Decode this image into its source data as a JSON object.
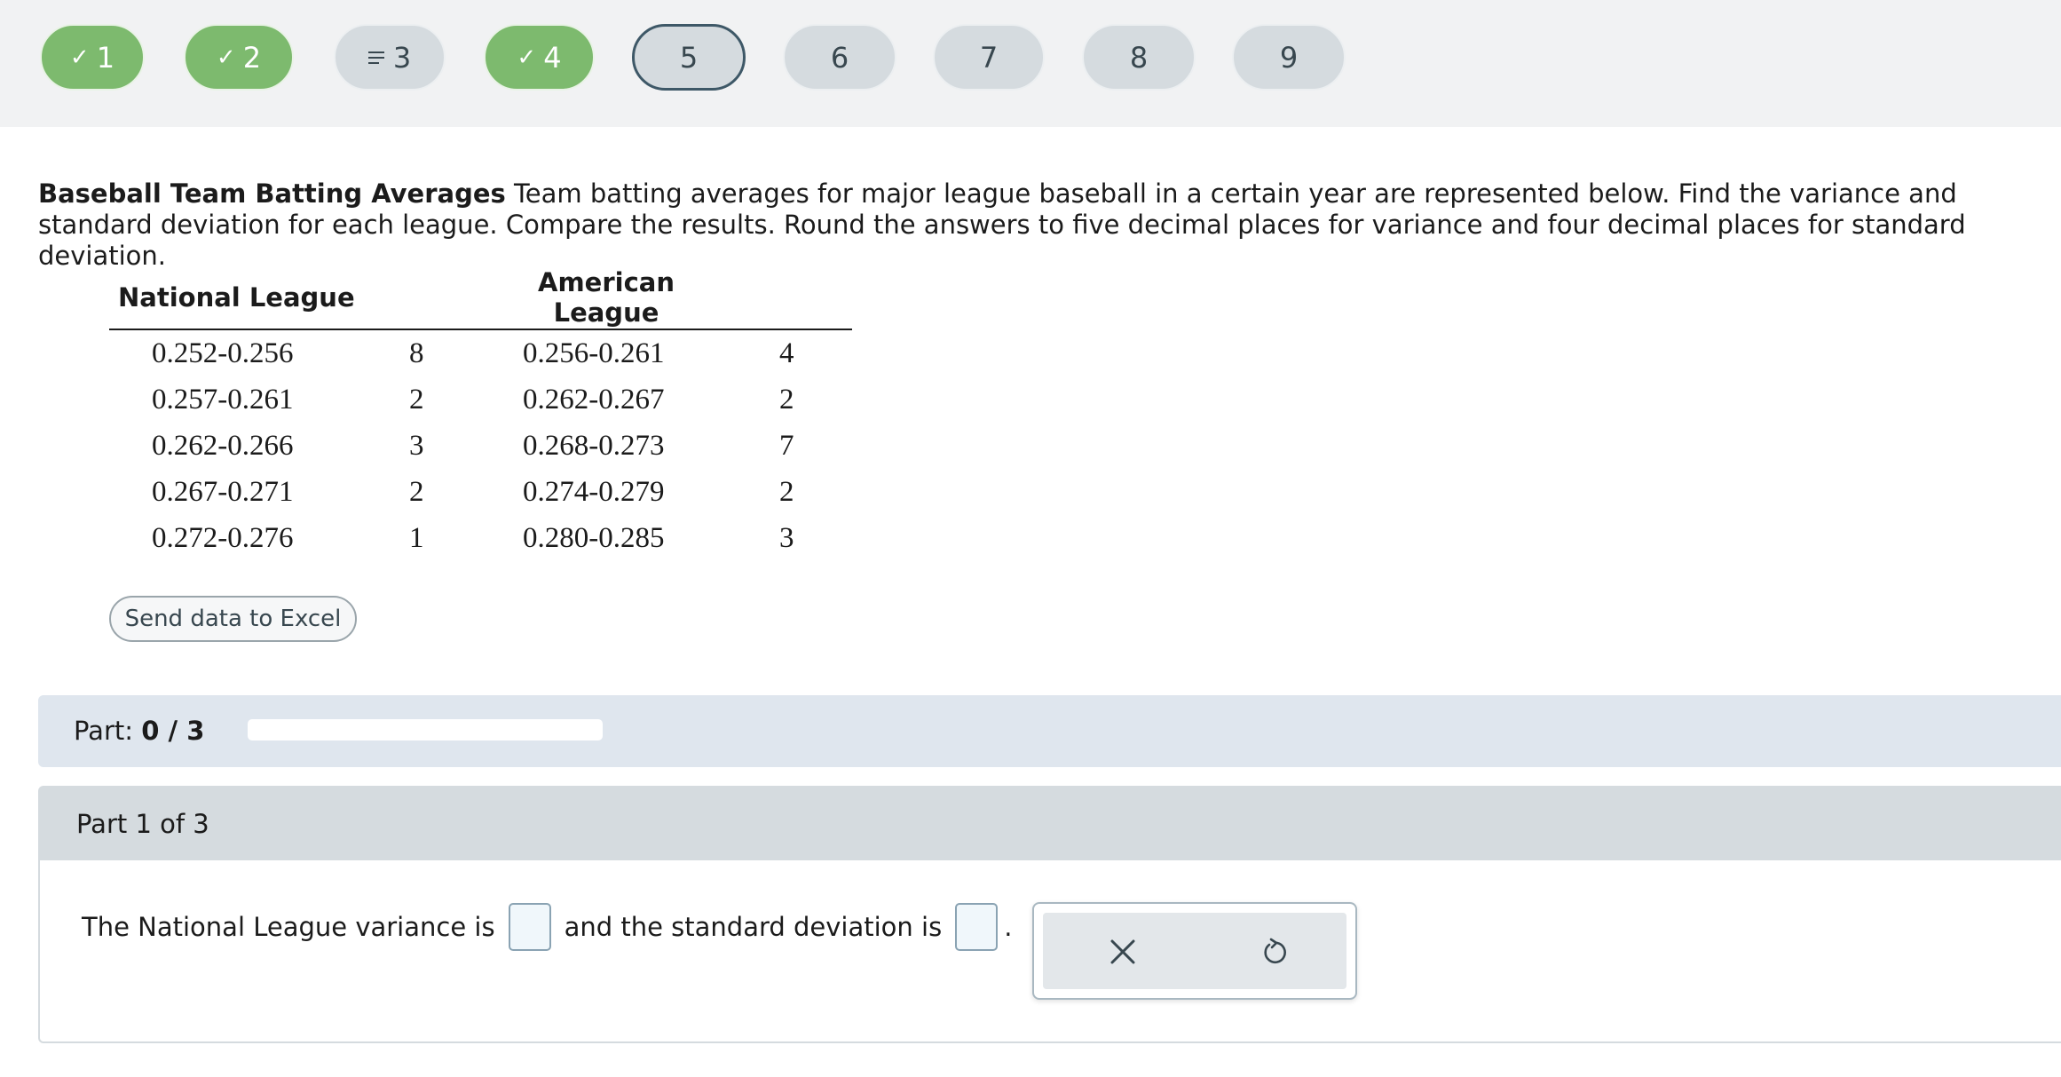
{
  "nav": {
    "questions": [
      {
        "label": "1",
        "state": "done",
        "icon": "check-icon"
      },
      {
        "label": "2",
        "state": "done",
        "icon": "check-icon"
      },
      {
        "label": "3",
        "state": "partial",
        "icon": "lines-icon"
      },
      {
        "label": "4",
        "state": "done",
        "icon": "check-icon"
      },
      {
        "label": "5",
        "state": "current",
        "icon": ""
      },
      {
        "label": "6",
        "state": "todo",
        "icon": ""
      },
      {
        "label": "7",
        "state": "todo",
        "icon": ""
      },
      {
        "label": "8",
        "state": "todo",
        "icon": ""
      },
      {
        "label": "9",
        "state": "todo",
        "icon": ""
      }
    ]
  },
  "problem": {
    "title": "Baseball Team Batting Averages",
    "text": "Team batting averages for major league baseball in a certain year are represented below. Find the variance and standard deviation for each league. Compare the results. Round the answers to five decimal places for variance and four decimal places for standard deviation."
  },
  "table": {
    "header_national": "National League",
    "header_american": "American League",
    "rows": [
      {
        "nl_class": "0.252-0.256",
        "nl_freq": "8",
        "al_class": "0.256-0.261",
        "al_freq": "4"
      },
      {
        "nl_class": "0.257-0.261",
        "nl_freq": "2",
        "al_class": "0.262-0.267",
        "al_freq": "2"
      },
      {
        "nl_class": "0.262-0.266",
        "nl_freq": "3",
        "al_class": "0.268-0.273",
        "al_freq": "7"
      },
      {
        "nl_class": "0.267-0.271",
        "nl_freq": "2",
        "al_class": "0.274-0.279",
        "al_freq": "2"
      },
      {
        "nl_class": "0.272-0.276",
        "nl_freq": "1",
        "al_class": "0.280-0.285",
        "al_freq": "3"
      }
    ]
  },
  "excel_button": "Send data to Excel",
  "part_progress": {
    "prefix": "Part:",
    "value": "0 / 3",
    "fraction": 0
  },
  "part1": {
    "heading": "Part 1 of 3",
    "text_before": "The National League variance is",
    "text_middle": "and the standard deviation is",
    "text_after": "."
  },
  "tools": {
    "clear_icon": "close-icon",
    "undo_icon": "undo-icon"
  },
  "colors": {
    "done": "#7dba6e",
    "pending": "#d5dbdf",
    "current_border": "#3e5867",
    "part_bar": "#dfe6ee"
  }
}
